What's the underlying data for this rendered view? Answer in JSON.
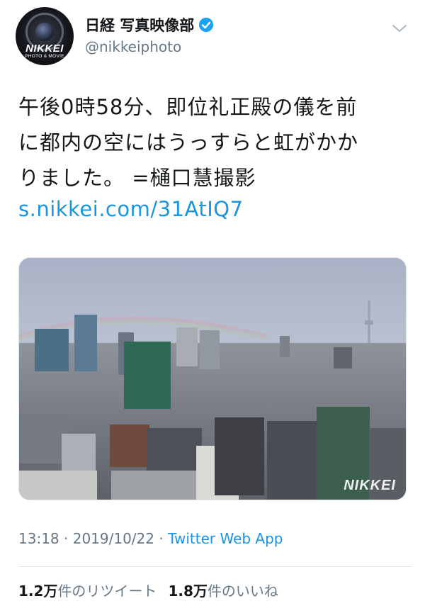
{
  "account": {
    "display_name": "日経 写真映像部",
    "handle": "@nikkeiphoto",
    "avatar_logo": "NIKKEI",
    "avatar_sub": "PHOTO & MOVIE"
  },
  "tweet": {
    "lines": [
      "午後0時58分、即位礼正殿の儀を前",
      "に都内の空にはうっすらと虹がかか",
      "りました。 =樋口慧撮影"
    ],
    "link": "s.nikkei.com/31AtIQ7",
    "photo_watermark": "NIKKEI"
  },
  "meta": {
    "time": "13:18",
    "separator1": " · ",
    "date": "2019/10/22",
    "separator2": " · ",
    "app": "Twitter Web App"
  },
  "stats": {
    "retweets_count": "1.2万",
    "retweets_label": "件のリツイート",
    "likes_count": "1.8万",
    "likes_label": "件のいいね"
  },
  "colors": {
    "link": "#1b95e0",
    "secondary_text": "#657786",
    "verified_badge": "#1da1f2"
  }
}
